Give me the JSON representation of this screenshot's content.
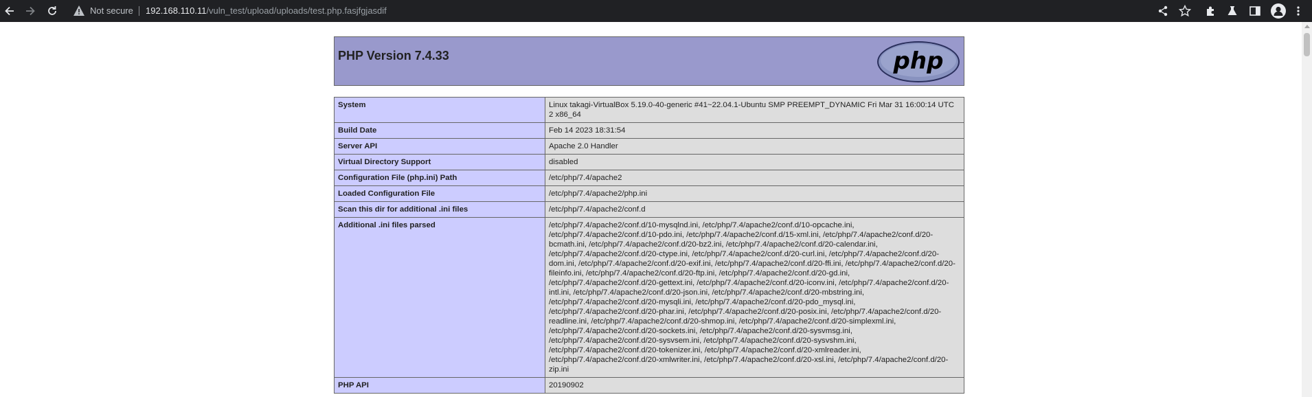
{
  "browser": {
    "security_label": "Not secure",
    "url_host": "192.168.110.11",
    "url_path": "/vuln_test/upload/uploads/test.php.fasjfgjasdif",
    "nav_icons": [
      "back-arrow-icon",
      "forward-arrow-icon",
      "reload-icon"
    ],
    "toolbar_icons": [
      "share-icon",
      "bookmark-star-icon",
      "extensions-puzzle-icon",
      "labs-flask-icon",
      "side-panel-icon",
      "profile-avatar-icon",
      "menu-kebab-icon"
    ]
  },
  "page": {
    "title": "PHP Version 7.4.33",
    "logo_text": "php",
    "colors": {
      "header_bg": "#9999cc",
      "label_bg": "#ccccff",
      "value_bg": "#dddddd",
      "border": "#666666"
    },
    "rows": [
      {
        "label": "System",
        "value": "Linux takagi-VirtualBox 5.19.0-40-generic #41~22.04.1-Ubuntu SMP PREEMPT_DYNAMIC Fri Mar 31 16:00:14 UTC 2 x86_64"
      },
      {
        "label": "Build Date",
        "value": "Feb 14 2023 18:31:54"
      },
      {
        "label": "Server API",
        "value": "Apache 2.0 Handler"
      },
      {
        "label": "Virtual Directory Support",
        "value": "disabled"
      },
      {
        "label": "Configuration File (php.ini) Path",
        "value": "/etc/php/7.4/apache2"
      },
      {
        "label": "Loaded Configuration File",
        "value": "/etc/php/7.4/apache2/php.ini"
      },
      {
        "label": "Scan this dir for additional .ini files",
        "value": "/etc/php/7.4/apache2/conf.d"
      },
      {
        "label": "Additional .ini files parsed",
        "value": "/etc/php/7.4/apache2/conf.d/10-mysqlnd.ini, /etc/php/7.4/apache2/conf.d/10-opcache.ini, /etc/php/7.4/apache2/conf.d/10-pdo.ini, /etc/php/7.4/apache2/conf.d/15-xml.ini, /etc/php/7.4/apache2/conf.d/20-bcmath.ini, /etc/php/7.4/apache2/conf.d/20-bz2.ini, /etc/php/7.4/apache2/conf.d/20-calendar.ini, /etc/php/7.4/apache2/conf.d/20-ctype.ini, /etc/php/7.4/apache2/conf.d/20-curl.ini, /etc/php/7.4/apache2/conf.d/20-dom.ini, /etc/php/7.4/apache2/conf.d/20-exif.ini, /etc/php/7.4/apache2/conf.d/20-ffi.ini, /etc/php/7.4/apache2/conf.d/20-fileinfo.ini, /etc/php/7.4/apache2/conf.d/20-ftp.ini, /etc/php/7.4/apache2/conf.d/20-gd.ini, /etc/php/7.4/apache2/conf.d/20-gettext.ini, /etc/php/7.4/apache2/conf.d/20-iconv.ini, /etc/php/7.4/apache2/conf.d/20-intl.ini, /etc/php/7.4/apache2/conf.d/20-json.ini, /etc/php/7.4/apache2/conf.d/20-mbstring.ini, /etc/php/7.4/apache2/conf.d/20-mysqli.ini, /etc/php/7.4/apache2/conf.d/20-pdo_mysql.ini, /etc/php/7.4/apache2/conf.d/20-phar.ini, /etc/php/7.4/apache2/conf.d/20-posix.ini, /etc/php/7.4/apache2/conf.d/20-readline.ini, /etc/php/7.4/apache2/conf.d/20-shmop.ini, /etc/php/7.4/apache2/conf.d/20-simplexml.ini, /etc/php/7.4/apache2/conf.d/20-sockets.ini, /etc/php/7.4/apache2/conf.d/20-sysvmsg.ini, /etc/php/7.4/apache2/conf.d/20-sysvsem.ini, /etc/php/7.4/apache2/conf.d/20-sysvshm.ini, /etc/php/7.4/apache2/conf.d/20-tokenizer.ini, /etc/php/7.4/apache2/conf.d/20-xmlreader.ini, /etc/php/7.4/apache2/conf.d/20-xmlwriter.ini, /etc/php/7.4/apache2/conf.d/20-xsl.ini, /etc/php/7.4/apache2/conf.d/20-zip.ini"
      },
      {
        "label": "PHP API",
        "value": "20190902"
      }
    ]
  }
}
